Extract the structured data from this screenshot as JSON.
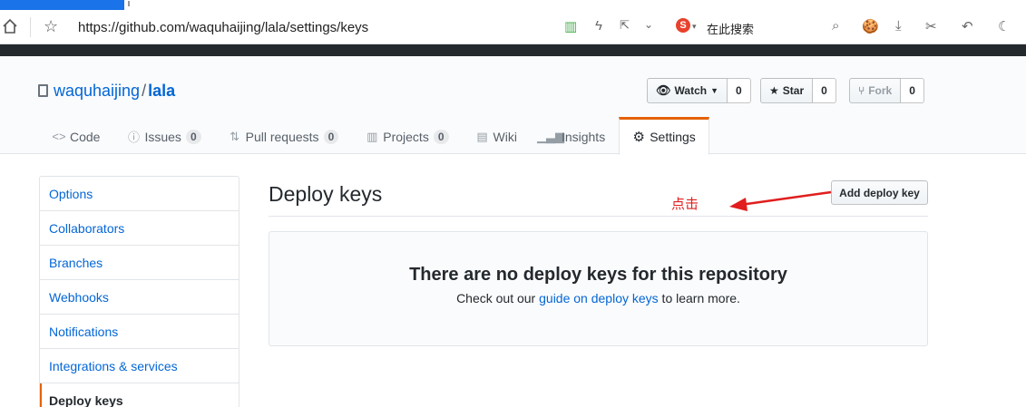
{
  "browser": {
    "url": "https://github.com/waquhaijing/lala/settings/keys",
    "search_placeholder": "在此搜索"
  },
  "repo": {
    "owner": "waquhaijing",
    "separator": "/",
    "name": "lala"
  },
  "actions": {
    "watch": {
      "label": "Watch",
      "count": "0"
    },
    "star": {
      "label": "Star",
      "count": "0"
    },
    "fork": {
      "label": "Fork",
      "count": "0"
    }
  },
  "tabs": [
    {
      "label": "Code",
      "icon": "code-icon"
    },
    {
      "label": "Issues",
      "count": "0",
      "icon": "issue-icon"
    },
    {
      "label": "Pull requests",
      "count": "0",
      "icon": "pull-request-icon"
    },
    {
      "label": "Projects",
      "count": "0",
      "icon": "project-icon"
    },
    {
      "label": "Wiki",
      "icon": "book-icon"
    },
    {
      "label": "Insights",
      "icon": "graph-icon"
    },
    {
      "label": "Settings",
      "icon": "gear-icon",
      "selected": true
    }
  ],
  "sidebar": {
    "items": [
      "Options",
      "Collaborators",
      "Branches",
      "Webhooks",
      "Notifications",
      "Integrations & services",
      "Deploy keys"
    ]
  },
  "main": {
    "title": "Deploy keys",
    "add_button": "Add deploy key",
    "annotation": "点击",
    "empty_title": "There are no deploy keys for this repository",
    "empty_prefix": "Check out our ",
    "empty_link": "guide on deploy keys",
    "empty_suffix": " to learn more."
  },
  "colors": {
    "accent": "#e36209",
    "link": "#0366d6",
    "annotation": "#e11d1d"
  }
}
